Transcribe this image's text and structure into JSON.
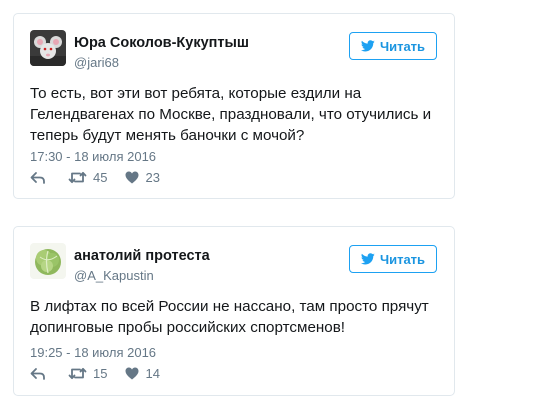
{
  "tweets": [
    {
      "author_name": "Юра Соколов-Кукуптыш",
      "handle": "@jari68",
      "follow_label": "Читать",
      "text": "То есть, вот эти вот ребята, которые ездили на Гелендвагенах по Москве, праздновали, что отучились и теперь будут менять баночки с мочой?",
      "timestamp": "17:30 - 18 июля 2016",
      "retweets": "45",
      "likes": "23",
      "avatar_icon": "cartoon-mouse-avatar"
    },
    {
      "author_name": "анатолий протеста",
      "handle": "@A_Kapustin",
      "follow_label": "Читать",
      "text": "В лифтах по всей России не нассано, там просто прячут допинговые пробы российских спортсменов!",
      "timestamp": "19:25 - 18 июля 2016",
      "retweets": "15",
      "likes": "14",
      "avatar_icon": "cabbage-avatar"
    }
  ],
  "colors": {
    "accent": "#1da1f2",
    "muted": "#657786",
    "border": "#e1e8ed",
    "text": "#14171a"
  }
}
